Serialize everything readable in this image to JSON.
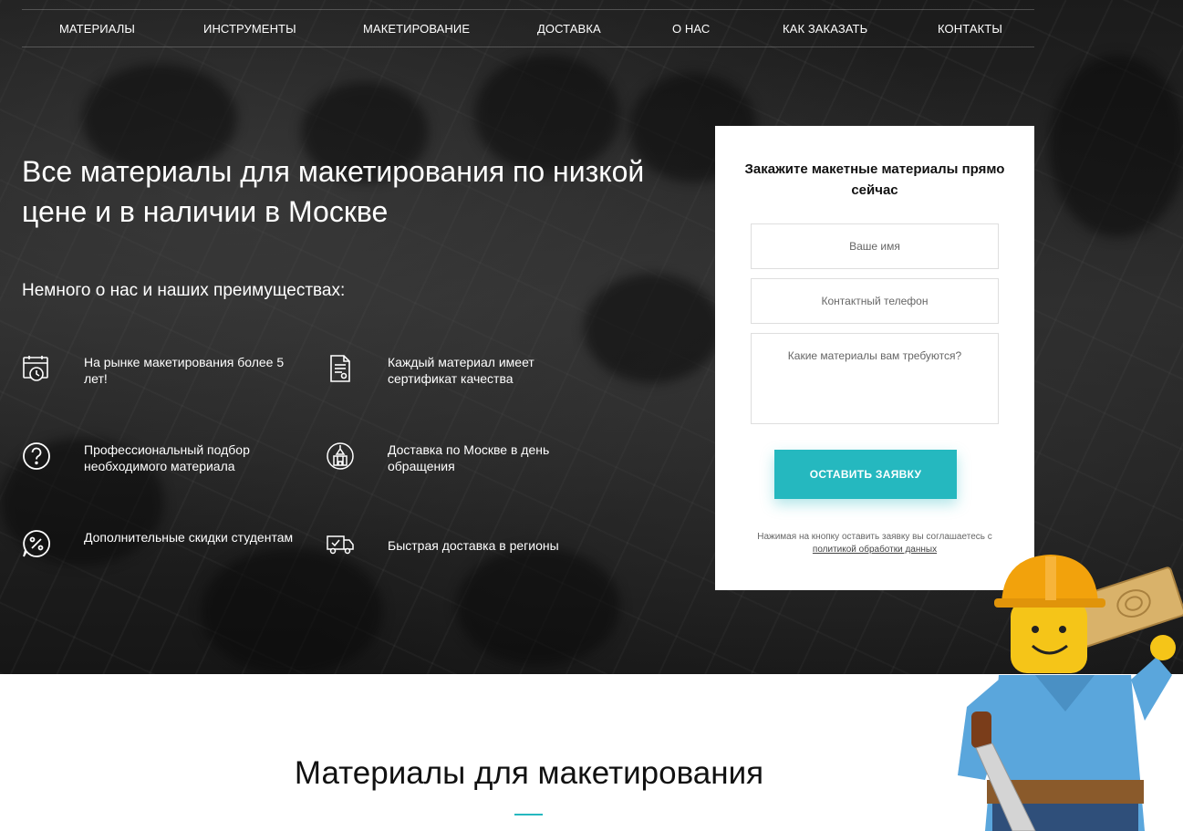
{
  "nav": {
    "items": [
      {
        "label": "МАТЕРИАЛЫ"
      },
      {
        "label": "ИНСТРУМЕНТЫ"
      },
      {
        "label": "МАКЕТИРОВАНИЕ"
      },
      {
        "label": "ДОСТАВКА"
      },
      {
        "label": "О НАС"
      },
      {
        "label": "КАК ЗАКАЗАТЬ"
      },
      {
        "label": "КОНТАКТЫ"
      }
    ]
  },
  "hero": {
    "headline": "Все материалы для макетирования по низкой цене и в наличии в Москве",
    "subhead": "Немного о нас и наших преимуществах:",
    "features": [
      {
        "icon": "calendar-clock-icon",
        "text": "На рынке макетирования более 5 лет!"
      },
      {
        "icon": "certificate-icon",
        "text": "Каждый материал имеет сертификат качества"
      },
      {
        "icon": "question-icon",
        "text": "Профессиональный подбор необходимого материала"
      },
      {
        "icon": "kremlin-icon",
        "text": "Доставка по Москве в день обращения"
      },
      {
        "icon": "percent-chat-icon",
        "text": "Дополнительные скидки студентам"
      },
      {
        "icon": "truck-icon",
        "text": "Быстрая доставка в регионы"
      }
    ]
  },
  "form": {
    "title": "Закажите макетные материалы прямо сейчас",
    "name_placeholder": "Ваше имя",
    "phone_placeholder": "Контактный телефон",
    "materials_placeholder": "Какие материалы вам требуются?",
    "submit_label": "ОСТАВИТЬ ЗАЯВКУ",
    "note_prefix": "Нажимая на кнопку оставить заявку вы соглашаетесь с",
    "note_link": "политикой обработки данных"
  },
  "section": {
    "title": "Материалы для макетирования"
  },
  "colors": {
    "accent": "#25b8bf",
    "hero_bg": "#1f1f1f"
  }
}
